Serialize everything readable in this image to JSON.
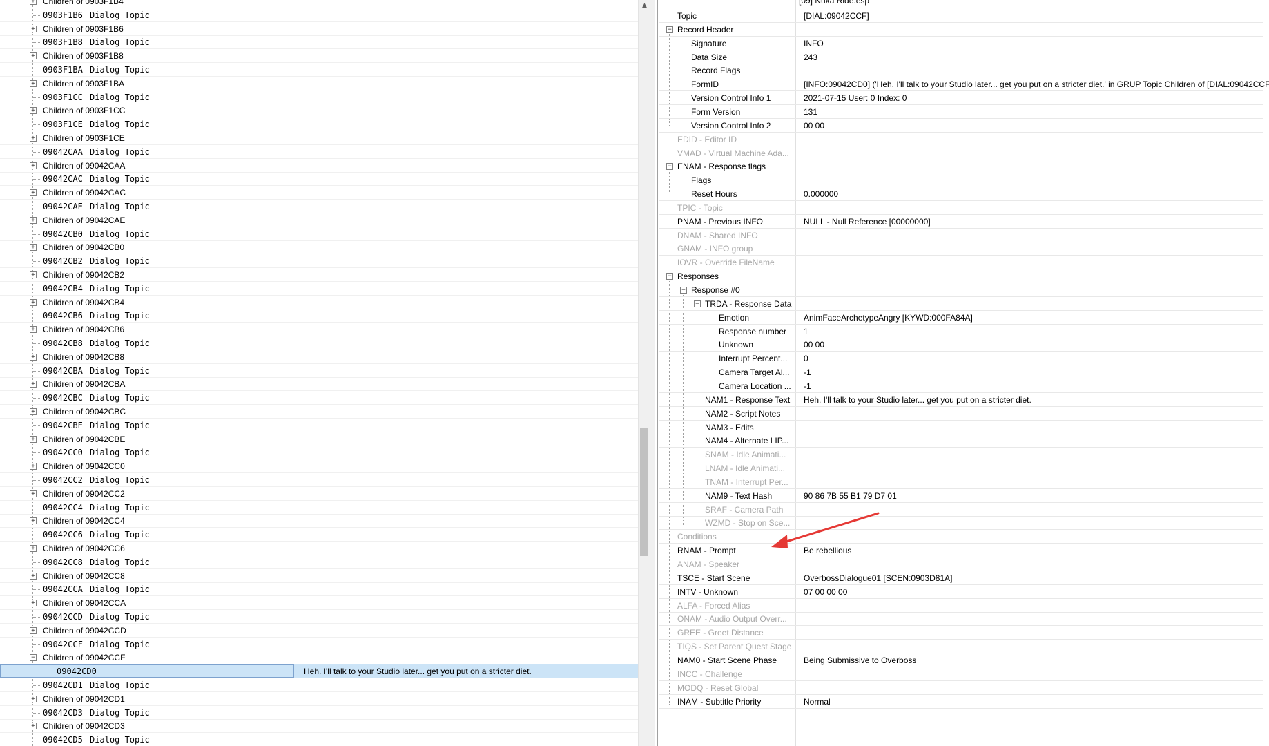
{
  "left_tree": {
    "rows": [
      {
        "kind": "child",
        "label": "Children of 0903F1B4",
        "partial": true
      },
      {
        "kind": "topic",
        "id": "0903F1B6",
        "type": "Dialog Topic"
      },
      {
        "kind": "child",
        "label": "Children of 0903F1B6"
      },
      {
        "kind": "topic",
        "id": "0903F1B8",
        "type": "Dialog Topic"
      },
      {
        "kind": "child",
        "label": "Children of 0903F1B8"
      },
      {
        "kind": "topic",
        "id": "0903F1BA",
        "type": "Dialog Topic"
      },
      {
        "kind": "child",
        "label": "Children of 0903F1BA"
      },
      {
        "kind": "topic",
        "id": "0903F1CC",
        "type": "Dialog Topic"
      },
      {
        "kind": "child",
        "label": "Children of 0903F1CC"
      },
      {
        "kind": "topic",
        "id": "0903F1CE",
        "type": "Dialog Topic"
      },
      {
        "kind": "child",
        "label": "Children of 0903F1CE"
      },
      {
        "kind": "topic",
        "id": "09042CAA",
        "type": "Dialog Topic"
      },
      {
        "kind": "child",
        "label": "Children of 09042CAA"
      },
      {
        "kind": "topic",
        "id": "09042CAC",
        "type": "Dialog Topic"
      },
      {
        "kind": "child",
        "label": "Children of 09042CAC"
      },
      {
        "kind": "topic",
        "id": "09042CAE",
        "type": "Dialog Topic"
      },
      {
        "kind": "child",
        "label": "Children of 09042CAE"
      },
      {
        "kind": "topic",
        "id": "09042CB0",
        "type": "Dialog Topic"
      },
      {
        "kind": "child",
        "label": "Children of 09042CB0"
      },
      {
        "kind": "topic",
        "id": "09042CB2",
        "type": "Dialog Topic"
      },
      {
        "kind": "child",
        "label": "Children of 09042CB2"
      },
      {
        "kind": "topic",
        "id": "09042CB4",
        "type": "Dialog Topic"
      },
      {
        "kind": "child",
        "label": "Children of 09042CB4"
      },
      {
        "kind": "topic",
        "id": "09042CB6",
        "type": "Dialog Topic"
      },
      {
        "kind": "child",
        "label": "Children of 09042CB6"
      },
      {
        "kind": "topic",
        "id": "09042CB8",
        "type": "Dialog Topic"
      },
      {
        "kind": "child",
        "label": "Children of 09042CB8"
      },
      {
        "kind": "topic",
        "id": "09042CBA",
        "type": "Dialog Topic"
      },
      {
        "kind": "child",
        "label": "Children of 09042CBA"
      },
      {
        "kind": "topic",
        "id": "09042CBC",
        "type": "Dialog Topic"
      },
      {
        "kind": "child",
        "label": "Children of 09042CBC"
      },
      {
        "kind": "topic",
        "id": "09042CBE",
        "type": "Dialog Topic"
      },
      {
        "kind": "child",
        "label": "Children of 09042CBE"
      },
      {
        "kind": "topic",
        "id": "09042CC0",
        "type": "Dialog Topic"
      },
      {
        "kind": "child",
        "label": "Children of 09042CC0"
      },
      {
        "kind": "topic",
        "id": "09042CC2",
        "type": "Dialog Topic"
      },
      {
        "kind": "child",
        "label": "Children of 09042CC2"
      },
      {
        "kind": "topic",
        "id": "09042CC4",
        "type": "Dialog Topic"
      },
      {
        "kind": "child",
        "label": "Children of 09042CC4"
      },
      {
        "kind": "topic",
        "id": "09042CC6",
        "type": "Dialog Topic"
      },
      {
        "kind": "child",
        "label": "Children of 09042CC6"
      },
      {
        "kind": "topic",
        "id": "09042CC8",
        "type": "Dialog Topic"
      },
      {
        "kind": "child",
        "label": "Children of 09042CC8"
      },
      {
        "kind": "topic",
        "id": "09042CCA",
        "type": "Dialog Topic"
      },
      {
        "kind": "child",
        "label": "Children of 09042CCA"
      },
      {
        "kind": "topic",
        "id": "09042CCD",
        "type": "Dialog Topic"
      },
      {
        "kind": "child",
        "label": "Children of 09042CCD"
      },
      {
        "kind": "topic",
        "id": "09042CCF",
        "type": "Dialog Topic"
      },
      {
        "kind": "child",
        "label": "Children of 09042CCF",
        "expanded": true
      },
      {
        "kind": "selected",
        "id": "09042CD0",
        "text": "Heh. I'll talk to your Studio later... get you put on a stricter diet."
      },
      {
        "kind": "topic",
        "id": "09042CD1",
        "type": "Dialog Topic"
      },
      {
        "kind": "child",
        "label": "Children of 09042CD1"
      },
      {
        "kind": "topic",
        "id": "09042CD3",
        "type": "Dialog Topic"
      },
      {
        "kind": "child",
        "label": "Children of 09042CD3"
      },
      {
        "kind": "topic",
        "id": "09042CD5",
        "type": "Dialog Topic"
      }
    ]
  },
  "record_view": {
    "file_header": "[09] Nuka Ride.esp",
    "rows": [
      {
        "name": "Topic",
        "value": "[DIAL:09042CCF]",
        "level": 0
      },
      {
        "name": "Record Header",
        "value": "",
        "level": 0,
        "expander": "minus"
      },
      {
        "name": "Signature",
        "value": "INFO",
        "level": 1
      },
      {
        "name": "Data Size",
        "value": "243",
        "level": 1
      },
      {
        "name": "Record Flags",
        "value": "",
        "level": 1
      },
      {
        "name": "FormID",
        "value": "[INFO:09042CD0] ('Heh. I'll talk to your Studio later... get you put on a stricter diet.' in GRUP Topic Children of [DIAL:09042CCF])",
        "level": 1
      },
      {
        "name": "Version Control Info 1",
        "value": "2021-07-15 User: 0 Index: 0",
        "level": 1
      },
      {
        "name": "Form Version",
        "value": "131",
        "level": 1
      },
      {
        "name": "Version Control Info 2",
        "value": "00 00",
        "level": 1
      },
      {
        "name": "EDID - Editor ID",
        "value": "",
        "level": 0,
        "dim": true
      },
      {
        "name": "VMAD - Virtual Machine Ada...",
        "value": "",
        "level": 0,
        "dim": true
      },
      {
        "name": "ENAM - Response flags",
        "value": "",
        "level": 0,
        "expander": "minus"
      },
      {
        "name": "Flags",
        "value": "",
        "level": 1
      },
      {
        "name": "Reset Hours",
        "value": "0.000000",
        "level": 1
      },
      {
        "name": "TPIC - Topic",
        "value": "",
        "level": 0,
        "dim": true
      },
      {
        "name": "PNAM - Previous INFO",
        "value": "NULL - Null Reference [00000000]",
        "level": 0
      },
      {
        "name": "DNAM - Shared INFO",
        "value": "",
        "level": 0,
        "dim": true
      },
      {
        "name": "GNAM - INFO group",
        "value": "",
        "level": 0,
        "dim": true
      },
      {
        "name": "IOVR - Override FileName",
        "value": "",
        "level": 0,
        "dim": true
      },
      {
        "name": "Responses",
        "value": "",
        "level": 0,
        "expander": "minus"
      },
      {
        "name": "Response #0",
        "value": "",
        "level": 1,
        "expander": "minus"
      },
      {
        "name": "TRDA - Response Data",
        "value": "",
        "level": 2,
        "expander": "minus"
      },
      {
        "name": "Emotion",
        "value": "AnimFaceArchetypeAngry [KYWD:000FA84A]",
        "level": 3
      },
      {
        "name": "Response number",
        "value": "1",
        "level": 3
      },
      {
        "name": "Unknown",
        "value": "00 00",
        "level": 3
      },
      {
        "name": "Interrupt Percent...",
        "value": "0",
        "level": 3
      },
      {
        "name": "Camera Target Al...",
        "value": "-1",
        "level": 3
      },
      {
        "name": "Camera Location ...",
        "value": "-1",
        "level": 3
      },
      {
        "name": "NAM1 - Response Text",
        "value": "Heh. I'll talk to your Studio later... get you put on a stricter diet.",
        "level": 2
      },
      {
        "name": "NAM2 - Script Notes",
        "value": "",
        "level": 2
      },
      {
        "name": "NAM3 - Edits",
        "value": "",
        "level": 2
      },
      {
        "name": "NAM4 - Alternate LIP...",
        "value": "",
        "level": 2
      },
      {
        "name": "SNAM - Idle Animati...",
        "value": "",
        "level": 2,
        "dim": true
      },
      {
        "name": "LNAM - Idle Animati...",
        "value": "",
        "level": 2,
        "dim": true
      },
      {
        "name": "TNAM - Interrupt Per...",
        "value": "",
        "level": 2,
        "dim": true
      },
      {
        "name": "NAM9 - Text Hash",
        "value": "90 86 7B 55 B1 79 D7 01",
        "level": 2
      },
      {
        "name": "SRAF - Camera Path",
        "value": "",
        "level": 2,
        "dim": true
      },
      {
        "name": "WZMD - Stop on Sce...",
        "value": "",
        "level": 2,
        "dim": true
      },
      {
        "name": "Conditions",
        "value": "",
        "level": 0,
        "dim": true
      },
      {
        "name": "RNAM - Prompt",
        "value": "Be rebellious",
        "level": 0
      },
      {
        "name": "ANAM - Speaker",
        "value": "",
        "level": 0,
        "dim": true
      },
      {
        "name": "TSCE - Start Scene",
        "value": "OverbossDialogue01 [SCEN:0903D81A]",
        "level": 0
      },
      {
        "name": "INTV - Unknown",
        "value": "07 00 00 00",
        "level": 0
      },
      {
        "name": "ALFA - Forced Alias",
        "value": "",
        "level": 0,
        "dim": true
      },
      {
        "name": "ONAM - Audio Output Overr...",
        "value": "",
        "level": 0,
        "dim": true
      },
      {
        "name": "GREE - Greet Distance",
        "value": "",
        "level": 0,
        "dim": true
      },
      {
        "name": "TIQS - Set Parent Quest Stage",
        "value": "",
        "level": 0,
        "dim": true
      },
      {
        "name": "NAM0 - Start Scene Phase",
        "value": "Being Submissive to Overboss",
        "level": 0
      },
      {
        "name": "INCC - Challenge",
        "value": "",
        "level": 0,
        "dim": true
      },
      {
        "name": "MODQ - Reset Global",
        "value": "",
        "level": 0,
        "dim": true
      },
      {
        "name": "INAM - Subtitle Priority",
        "value": "Normal",
        "level": 0
      }
    ]
  },
  "annotation": {
    "color": "#e53935",
    "icon": "red-arrow-icon"
  },
  "colors": {
    "selection": "#cce4f7",
    "dim_text": "#a8a8a8"
  }
}
